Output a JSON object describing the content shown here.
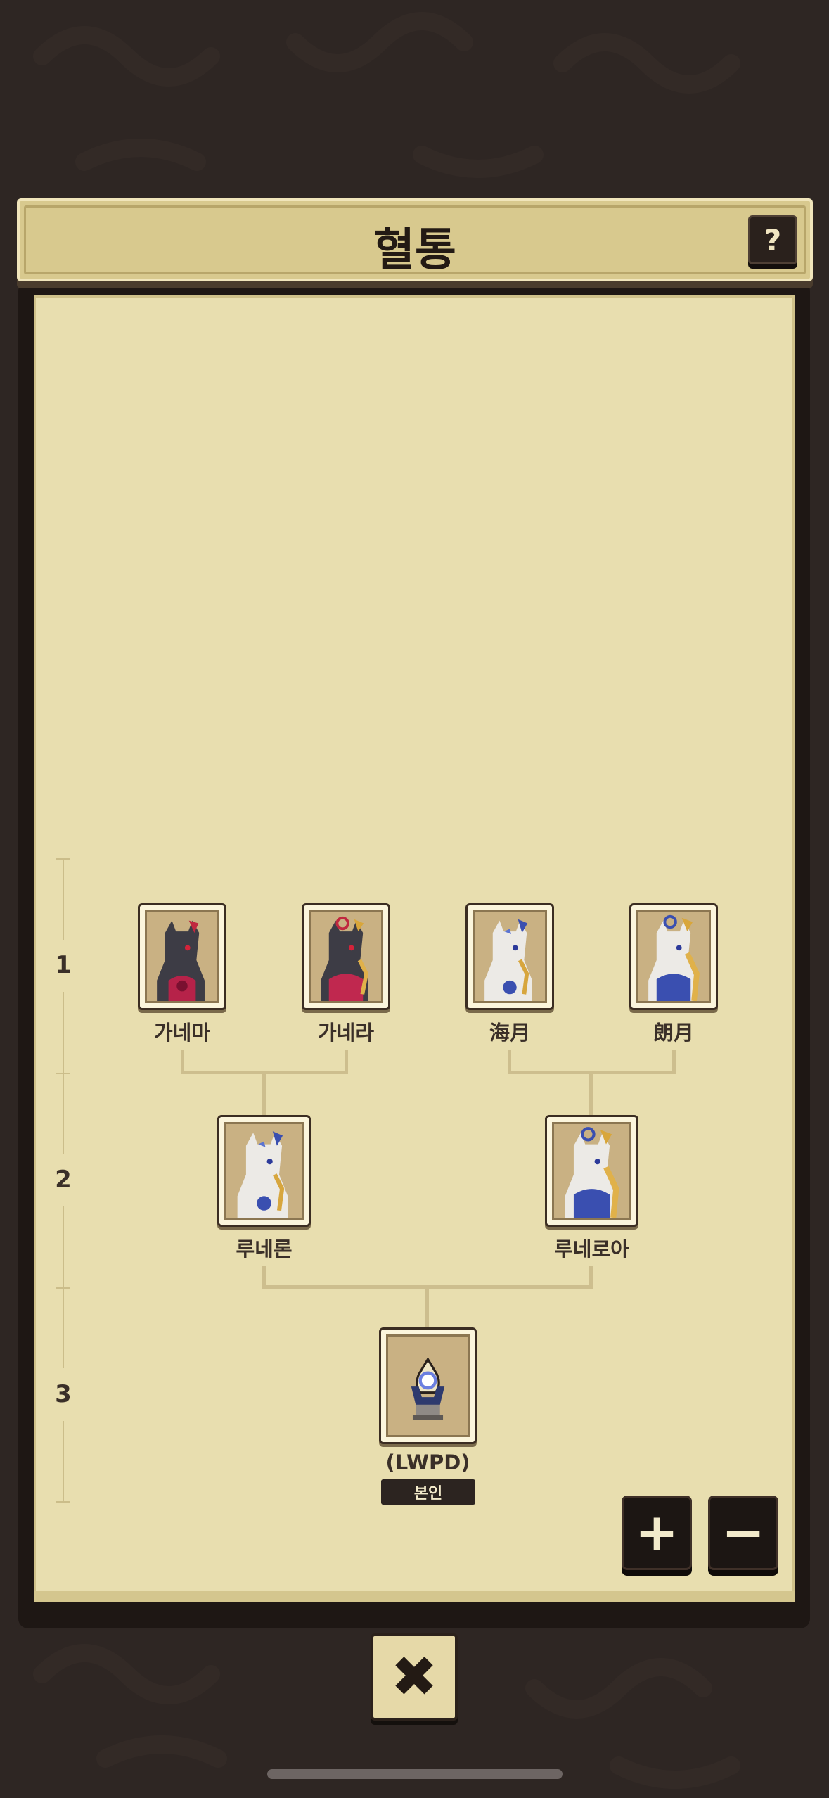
{
  "header": {
    "title": "혈통",
    "help_label": "?"
  },
  "generations": [
    "1",
    "2",
    "3"
  ],
  "tree": {
    "gen1": [
      {
        "name": "가네마",
        "icon": "dark-dragon-red-horns-portrait"
      },
      {
        "name": "가네라",
        "icon": "dark-dragon-gold-crown-portrait"
      },
      {
        "name": "海月",
        "icon": "white-dragon-blue-portrait"
      },
      {
        "name": "朗月",
        "icon": "white-dragon-gold-crown-portrait"
      }
    ],
    "gen2": [
      {
        "name": "루네론",
        "icon": "white-dragon-blue-portrait"
      },
      {
        "name": "루네로아",
        "icon": "white-dragon-gold-crown-portrait"
      }
    ],
    "self": {
      "name": "(LWPD)",
      "badge": "본인",
      "icon": "egg-on-pedestal-portrait"
    }
  },
  "controls": {
    "zoom_in_label": "+",
    "zoom_out_label": "−",
    "close_label": "✖"
  },
  "colors": {
    "background": "#2e2623",
    "paper": "#e8deaf",
    "header": "#d8c98e",
    "dark_button": "#1c1613"
  }
}
